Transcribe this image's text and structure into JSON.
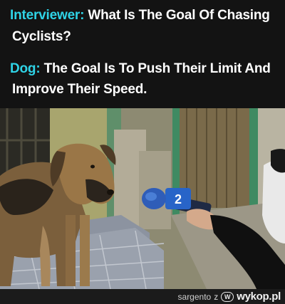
{
  "colors": {
    "accent": "#2fd3e6",
    "caption_bg": "#131313",
    "text": "#ffffff"
  },
  "caption": {
    "question_speaker": "Interviewer:",
    "question_line1": "What Is The Goal Of Chasing",
    "question_line2": "Cyclists?",
    "answer_speaker": "Dog:",
    "answer_line1": "The Goal Is To Push Their Limit And",
    "answer_line2": "Improve Their Speed."
  },
  "photo": {
    "microphone_flag_text": "2"
  },
  "footer": {
    "user": "sargento",
    "separator": "z",
    "brand_icon": "wykop-logo-icon",
    "brand": "wykop.pl"
  }
}
